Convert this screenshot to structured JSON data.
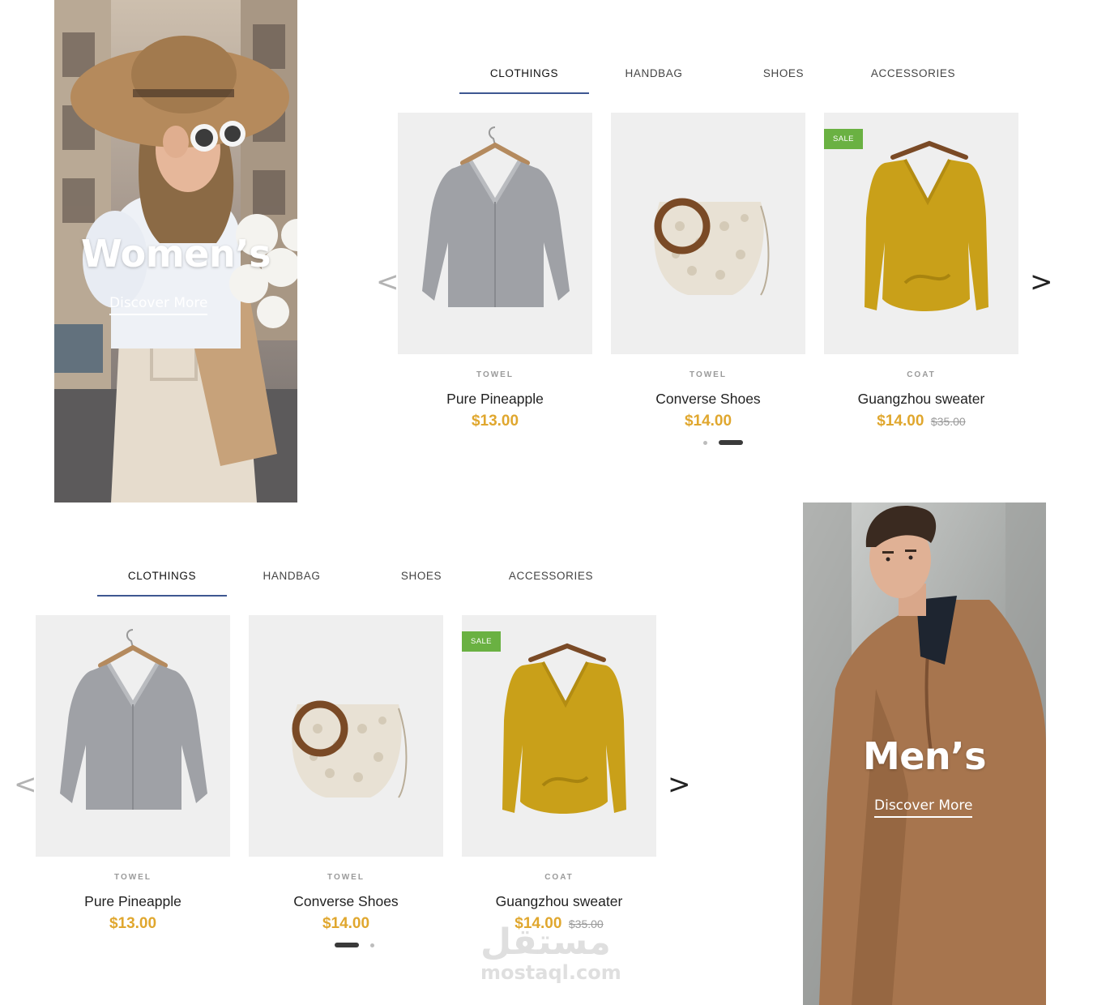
{
  "top": {
    "banner": {
      "title": "Women’s",
      "link": "Discover More"
    },
    "tabs": [
      "CLOTHINGS",
      "HANDBAG",
      "SHOES",
      "ACCESSORIES"
    ],
    "products": [
      {
        "category": "TOWEL",
        "name": "Pure Pineapple",
        "price": "$13.00",
        "old_price": "",
        "badge": ""
      },
      {
        "category": "TOWEL",
        "name": "Converse Shoes",
        "price": "$14.00",
        "old_price": "",
        "badge": ""
      },
      {
        "category": "COAT",
        "name": "Guangzhou sweater",
        "price": "$14.00",
        "old_price": "$35.00",
        "badge": "SALE"
      }
    ],
    "prev": "<",
    "next": ">"
  },
  "bottom": {
    "banner": {
      "title": "Men’s",
      "link": "Discover More"
    },
    "tabs": [
      "CLOTHINGS",
      "HANDBAG",
      "SHOES",
      "ACCESSORIES"
    ],
    "products": [
      {
        "category": "TOWEL",
        "name": "Pure Pineapple",
        "price": "$13.00",
        "old_price": "",
        "badge": ""
      },
      {
        "category": "TOWEL",
        "name": "Converse Shoes",
        "price": "$14.00",
        "old_price": "",
        "badge": ""
      },
      {
        "category": "COAT",
        "name": "Guangzhou sweater",
        "price": "$14.00",
        "old_price": "$35.00",
        "badge": "SALE"
      }
    ],
    "prev": "<",
    "next": ">"
  },
  "watermark": {
    "arabic": "مستقل",
    "latin": "mostaql.com"
  },
  "colors": {
    "accent": "#3e5791",
    "price": "#e0a72e",
    "sale_badge": "#6ab142"
  }
}
